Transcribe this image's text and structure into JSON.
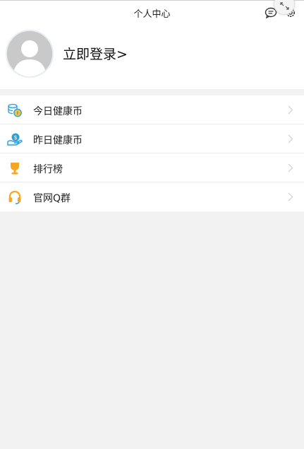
{
  "header": {
    "title": "个人中心"
  },
  "profile": {
    "login_label": "立即登录",
    "login_arrow": ">"
  },
  "menu": {
    "items": [
      {
        "label": "今日健康币",
        "icon": "coins-icon"
      },
      {
        "label": "昨日健康币",
        "icon": "hand-coin-icon"
      },
      {
        "label": "排行榜",
        "icon": "trophy-icon"
      },
      {
        "label": "官网Q群",
        "icon": "headset-icon"
      }
    ]
  },
  "colors": {
    "background": "#f2f2f2",
    "card": "#ffffff",
    "blue_icon": "#2a9fd8",
    "orange_icon": "#f5a623",
    "chevron": "#cfcfcf"
  }
}
